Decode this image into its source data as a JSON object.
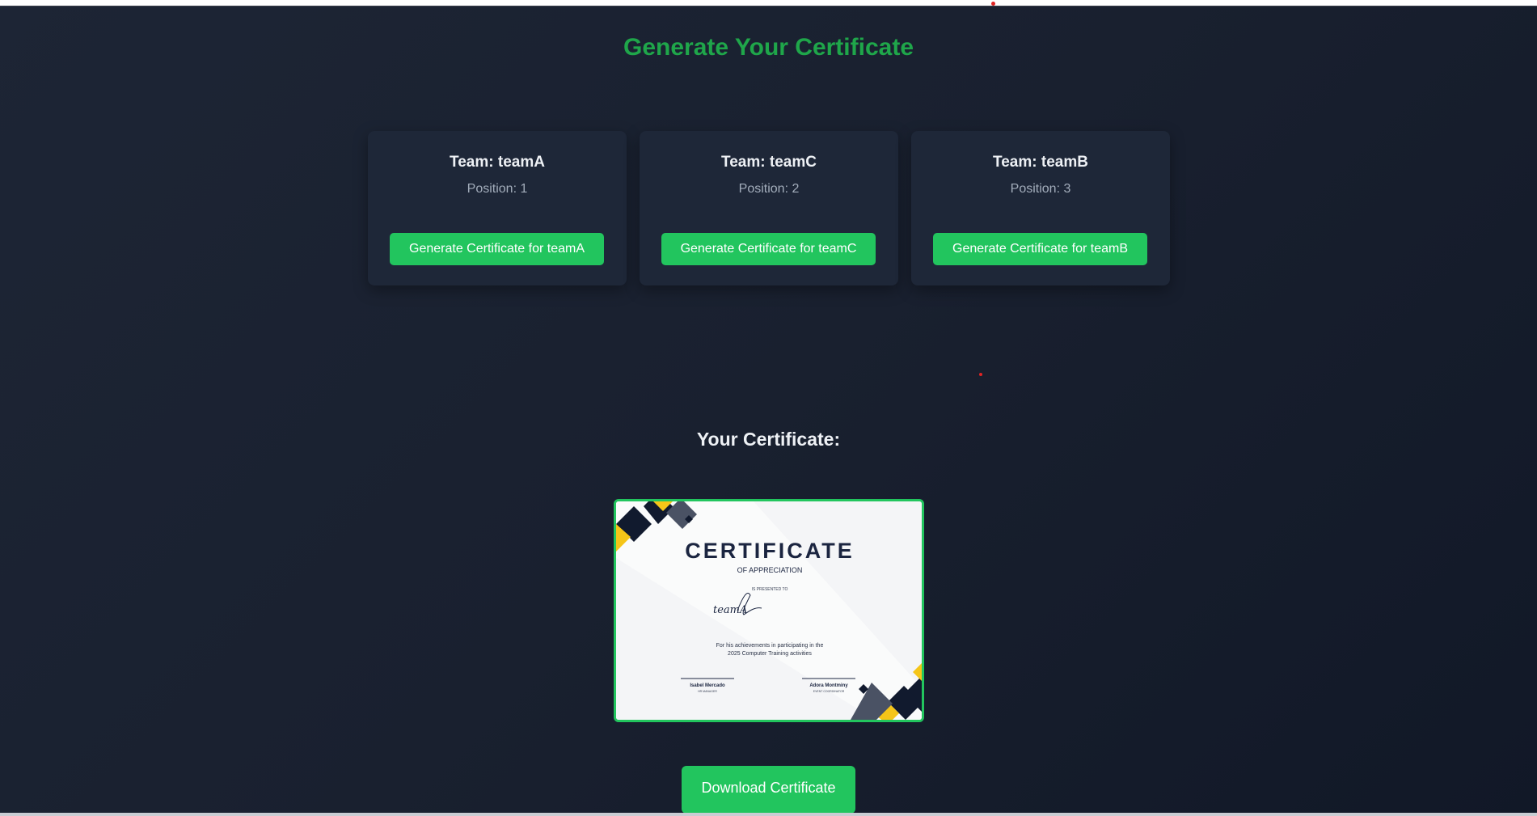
{
  "page": {
    "title": "Generate Your Certificate"
  },
  "teams": [
    {
      "team_label": "Team: teamA",
      "position_label": "Position: 1",
      "button_label": "Generate Certificate for teamA"
    },
    {
      "team_label": "Team: teamC",
      "position_label": "Position: 2",
      "button_label": "Generate Certificate for teamC"
    },
    {
      "team_label": "Team: teamB",
      "position_label": "Position: 3",
      "button_label": "Generate Certificate for teamB"
    }
  ],
  "certificate_section": {
    "heading": "Your Certificate:",
    "download_label": "Download Certificate"
  },
  "certificate": {
    "title": "CERTIFICATE",
    "subtitle": "OF APPRECIATION",
    "presented": "IS PRESENTED TO",
    "signature": "teamA",
    "body_line1": "For his achievements in participating in the",
    "body_line2": "2025 Computer Training activities",
    "signer1_name": "Isabel Mercado",
    "signer1_role": "HR MANAGER",
    "signer2_name": "Adora Montminy",
    "signer2_role": "EVENT COORDINATOR"
  },
  "colors": {
    "accent": "#22c55e",
    "title_green": "#1fa64a",
    "background": "#19202f",
    "card": "#1e2738",
    "cert_navy": "#111a2e",
    "cert_slate": "#4a5264",
    "cert_yellow": "#f5c518"
  }
}
